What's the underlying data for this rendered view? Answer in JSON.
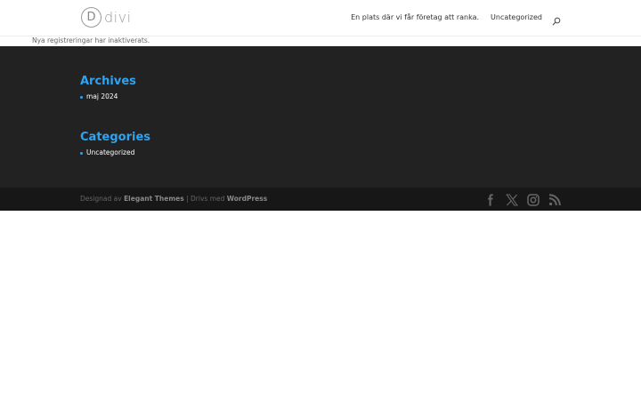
{
  "header": {
    "logo_letter": "D",
    "logo_text": "divi",
    "nav_items": [
      {
        "label": "En plats där vi får företag att ranka."
      },
      {
        "label": "Uncategorized"
      }
    ],
    "search_icon": "search-icon"
  },
  "notice": "Nya registreringar har inaktiverats.",
  "widgets": {
    "archives": {
      "title": "Archives",
      "items": [
        "maj 2024"
      ]
    },
    "categories": {
      "title": "Categories",
      "items": [
        "Uncategorized"
      ]
    }
  },
  "footer": {
    "credit_prefix": "Designad av",
    "credit_theme": "Elegant Themes",
    "credit_separator": "| Drivs med",
    "credit_platform": "WordPress",
    "social_icons": [
      "facebook-icon",
      "x-icon",
      "instagram-icon",
      "rss-icon"
    ]
  },
  "colors": {
    "accent": "#2ea3f2",
    "widgets_bg": "#222222",
    "bottom_bar_bg": "#171717",
    "icon": "#666666"
  }
}
